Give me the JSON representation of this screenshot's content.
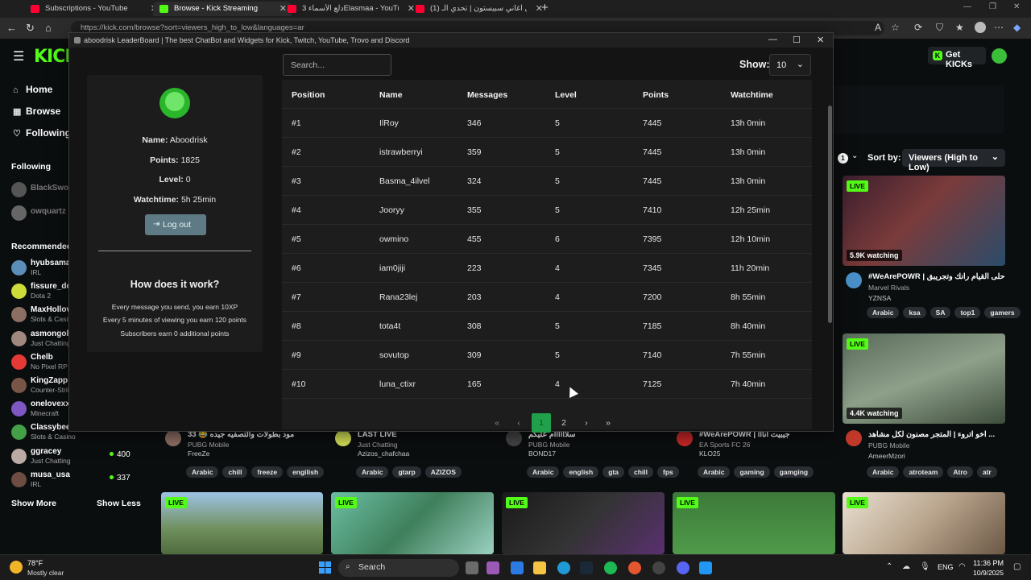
{
  "browser": {
    "tabs": [
      {
        "title": "Subscriptions - YouTube",
        "active": false,
        "favicon_color": "#ff0033"
      },
      {
        "title": "Browse - Kick Streaming",
        "active": true,
        "favicon_color": "#53fc18"
      },
      {
        "title": "دلع الأسماء 3Elasmaa - YouTube",
        "active": false,
        "favicon_color": "#ff0033"
      },
      {
        "title": "(1) تحدي اغاني سبيستون | تحدي الـ",
        "active": false,
        "favicon_color": "#ff0033"
      }
    ],
    "url": "https://kick.com/browse?sort=viewers_high_to_low&languages=ar"
  },
  "kick": {
    "logo": "KICK",
    "get_kicks": "Get KICKs",
    "nav": {
      "home": "Home",
      "browse": "Browse",
      "following": "Following"
    },
    "following_header": "Following",
    "following": [
      {
        "name": "BlackSwo",
        "color": "#555"
      },
      {
        "name": "owquartz",
        "color": "#666"
      }
    ],
    "recommended_header": "Recommended",
    "recommended": [
      {
        "name": "hyubsama",
        "cat": "IRL",
        "viewers": "",
        "color": "#5b8fb9"
      },
      {
        "name": "fissure_do",
        "cat": "Dota 2",
        "viewers": "",
        "color": "#cddc39"
      },
      {
        "name": "MaxHollov",
        "cat": "Slots & Casino",
        "viewers": "",
        "color": "#8d6e63"
      },
      {
        "name": "asmongold",
        "cat": "Just Chatting",
        "viewers": "",
        "color": "#a1887f"
      },
      {
        "name": "Chelb",
        "cat": "No Pixel RP",
        "viewers": "",
        "color": "#e53935"
      },
      {
        "name": "KingZapp",
        "cat": "Counter-Strike",
        "viewers": "",
        "color": "#795548"
      },
      {
        "name": "onelovexx",
        "cat": "Minecraft",
        "viewers": "",
        "color": "#7e57c2"
      },
      {
        "name": "Classybee",
        "cat": "Slots & Casino",
        "viewers": "",
        "color": "#43a047"
      },
      {
        "name": "ggracey",
        "cat": "Just Chatting",
        "viewers": "400",
        "color": "#bcaaa4"
      },
      {
        "name": "musa_usa",
        "cat": "IRL",
        "viewers": "337",
        "color": "#6d4c41"
      }
    ],
    "show_more": "Show More",
    "show_less": "Show Less",
    "sort_count": "1",
    "sort_label": "Sort by:",
    "sort_value": "Viewers (High to Low)",
    "right_cards": [
      {
        "live": "LIVE",
        "watching": "5.9K watching",
        "title": "#WeArePOWR | حلى القيام رانك وتجريبق ...",
        "cat": "Marvel Rivals",
        "streamer": "YZNSA",
        "tags": [
          "Arabic",
          "ksa",
          "SA",
          "top1",
          "gamers"
        ]
      },
      {
        "live": "LIVE",
        "watching": "4.4K watching",
        "title": "اخو اتروء | المتجر مصنون لكل مشاهد ...",
        "cat": "PUBG Mobile",
        "streamer": "AmeerMzori",
        "tags": [
          "Arabic",
          "atroteam",
          "Atro",
          "atr"
        ]
      }
    ],
    "bottom_cards": [
      {
        "title": "مود بطولات والتصفيه جيده 😂 33",
        "cat": "PUBG Mobile",
        "streamer": "FreeZe",
        "tags": [
          "Arabic",
          "chill",
          "freeze",
          "engilish"
        ]
      },
      {
        "title": "LAST LIVE",
        "cat": "Just Chatting",
        "streamer": "Azizos_chafchaa",
        "tags": [
          "Arabic",
          "gtarp",
          "AZIZOS"
        ]
      },
      {
        "title": "سلاااااام عليكم",
        "cat": "PUBG Mobile",
        "streamer": "BOND17",
        "tags": [
          "Arabic",
          "english",
          "gta",
          "chill",
          "fps"
        ]
      },
      {
        "title": "#WeArePOWR | جيبيت انااا",
        "cat": "EA Sports FC 26",
        "streamer": "KLO25",
        "tags": [
          "Arabic",
          "gaming",
          "gamging"
        ]
      }
    ],
    "bottom_live": "LIVE"
  },
  "popup": {
    "window_title": "aboodrisk LeaderBoard | The best ChatBot and Widgets for Kick, Twitch, YouTube, Trovo and Discord",
    "profile": {
      "name_label": "Name:",
      "name": "Aboodrisk",
      "points_label": "Points:",
      "points": "1825",
      "level_label": "Level:",
      "level": "0",
      "watchtime_label": "Watchtime:",
      "watchtime": "5h 25min",
      "logout": "Log out"
    },
    "how": {
      "title": "How does it work?",
      "line1": "Every message you send, you earn 10XP",
      "line2": "Every 5 minutes of viewing you earn 120 points",
      "line3": "Subscribers earn 0 additional points"
    },
    "search_placeholder": "Search...",
    "show_label": "Show:",
    "show_value": "10",
    "columns": [
      "Position",
      "Name",
      "Messages",
      "Level",
      "Points",
      "Watchtime"
    ],
    "rows": [
      [
        "#1",
        "IlRoy",
        "346",
        "5",
        "7445",
        "13h 0min"
      ],
      [
        "#2",
        "istrawberryi",
        "359",
        "5",
        "7445",
        "13h 0min"
      ],
      [
        "#3",
        "Basma_4ilvel",
        "324",
        "5",
        "7445",
        "13h 0min"
      ],
      [
        "#4",
        "Jooryy",
        "355",
        "5",
        "7410",
        "12h 25min"
      ],
      [
        "#5",
        "owmino",
        "455",
        "6",
        "7395",
        "12h 10min"
      ],
      [
        "#6",
        "iam0jiji",
        "223",
        "4",
        "7345",
        "11h 20min"
      ],
      [
        "#7",
        "Rana23lej",
        "203",
        "4",
        "7200",
        "8h 55min"
      ],
      [
        "#8",
        "tota4t",
        "308",
        "5",
        "7185",
        "8h 40min"
      ],
      [
        "#9",
        "sovutop",
        "309",
        "5",
        "7140",
        "7h 55min"
      ],
      [
        "#10",
        "luna_ctixr",
        "165",
        "4",
        "7125",
        "7h 40min"
      ]
    ],
    "pagination": {
      "first": "«",
      "prev": "‹",
      "page1": "1",
      "page2": "2",
      "next": "›",
      "last": "»"
    }
  },
  "taskbar": {
    "temp": "78°F",
    "weather": "Mostly clear",
    "search": "Search",
    "lang": "ENG",
    "time": "11:36 PM",
    "date": "10/9/2025"
  }
}
